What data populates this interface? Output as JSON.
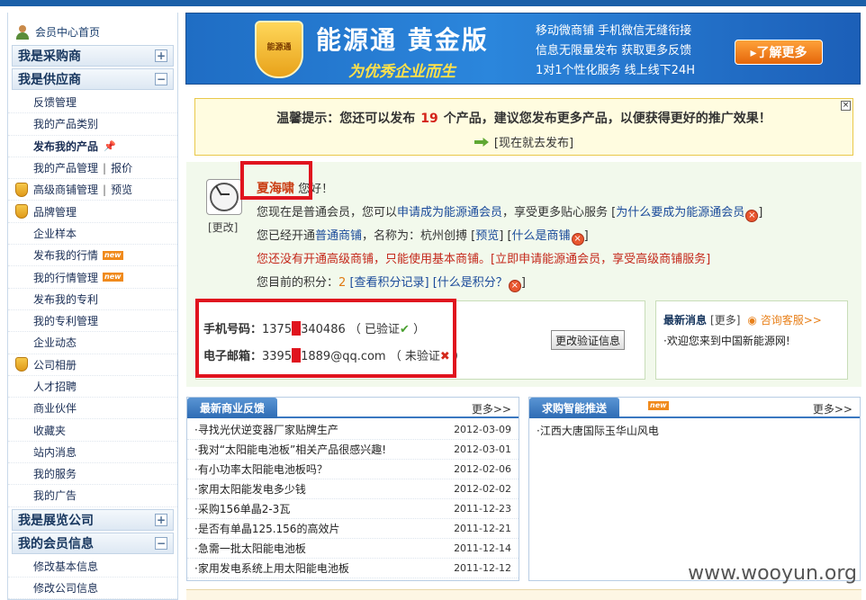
{
  "sidebar": {
    "home": "会员中心首页",
    "sections": [
      {
        "title": "我是采购商",
        "toggle": "+"
      },
      {
        "title": "我是供应商",
        "toggle": "−"
      }
    ],
    "items": [
      {
        "label": "反馈管理"
      },
      {
        "label": "我的产品类别"
      },
      {
        "label": "发布我的产品"
      },
      {
        "label": "我的产品管理",
        "extra": "报价"
      },
      {
        "label": "高级商铺管理",
        "extra": "预览"
      },
      {
        "label": "品牌管理"
      },
      {
        "label": "企业样本"
      },
      {
        "label": "发布我的行情",
        "tag": "new"
      },
      {
        "label": "我的行情管理",
        "tag": "new"
      },
      {
        "label": "发布我的专利"
      },
      {
        "label": "我的专利管理"
      },
      {
        "label": "企业动态"
      },
      {
        "label": "公司相册"
      },
      {
        "label": "人才招聘"
      },
      {
        "label": "商业伙伴"
      },
      {
        "label": "收藏夹"
      },
      {
        "label": "站内消息"
      },
      {
        "label": "我的服务"
      },
      {
        "label": "我的广告"
      }
    ],
    "sections2": [
      {
        "title": "我是展览公司",
        "toggle": "+"
      },
      {
        "title": "我的会员信息",
        "toggle": "−"
      }
    ],
    "items2": [
      {
        "label": "修改基本信息"
      },
      {
        "label": "修改公司信息"
      }
    ]
  },
  "banner": {
    "logo": "能源通",
    "title": "能源通 黄金版",
    "subtitle": "为优秀企业而生",
    "lines": [
      "移动微商铺  手机微信无缝衔接",
      "信息无限量发布  获取更多反馈",
      "1对1个性化服务  线上线下24H"
    ],
    "button": "▸了解更多"
  },
  "notice": {
    "prefix": "温馨提示：您还可以发布",
    "count": "19",
    "suffix": "个产品，建议您发布更多产品，以便获得更好的推广效果！",
    "action": "[现在就去发布]",
    "close": "×"
  },
  "profile": {
    "change": "[更改]",
    "username": "夏海啸",
    "greeting": "您好！",
    "line1_a": "您现在是普通会员，您可以",
    "line1_link": "申请成为能源通会员",
    "line1_b": "，享受更多贴心服务 [",
    "line1_link2": "为什么要成为能源通会员",
    "line1_c": "]",
    "line2_a": "您已经开通",
    "line2_link": "普通商铺",
    "line2_b": "，名称为：杭州创搏 [",
    "line2_link2": "预览",
    "line2_c": "] [",
    "line2_link3": "什么是商铺",
    "line2_d": "]",
    "line3": "您还没有开通高级商铺，只能使用基本商铺。",
    "line3_link": "[立即申请能源通会员，享受高级商铺服务]",
    "line4_a": "您目前的积分：",
    "points": "2",
    "line4_link": "[查看积分记录]",
    "line4_link2": "[什么是积分？",
    "line4_c": "]"
  },
  "contact": {
    "phone_label": "手机号码：",
    "phone_a": "1375",
    "phone_b": "340486",
    "phone_status": "（ 已验证",
    "phone_end": " ）",
    "email_label": "电子邮箱：",
    "email_a": "3395",
    "email_b": "1889@qq.com",
    "email_status": "（ 未验证",
    "email_end": " ）",
    "button": "更改验证信息"
  },
  "latest": {
    "title": "最新消息",
    "more": "[更多]",
    "service": "咨询客服>>",
    "item": "·欢迎您来到中国新能源网!"
  },
  "feedback": {
    "tab": "最新商业反馈",
    "more": "更多>>",
    "rows": [
      {
        "title": "·寻找光伏逆变器厂家贴牌生产",
        "date": "2012-03-09"
      },
      {
        "title": "·我对“太阳能电池板”相关产品很感兴趣!",
        "date": "2012-03-01"
      },
      {
        "title": "·有小功率太阳能电池板吗？",
        "date": "2012-02-06"
      },
      {
        "title": "·家用太阳能发电多少钱",
        "date": "2012-02-02"
      },
      {
        "title": "·采购156单晶2-3瓦",
        "date": "2011-12-23"
      },
      {
        "title": "·是否有单晶125.156的高效片",
        "date": "2011-12-21"
      },
      {
        "title": "·急需一批太阳能电池板",
        "date": "2011-12-14"
      },
      {
        "title": "·家用发电系统上用太阳能电池板",
        "date": "2011-12-12"
      }
    ]
  },
  "purchase": {
    "tab": "求购智能推送",
    "tag": "new",
    "more": "更多>>",
    "rows": [
      {
        "title": "·江西大唐国际玉华山风电"
      }
    ]
  },
  "watermark": "www.wooyun.org"
}
